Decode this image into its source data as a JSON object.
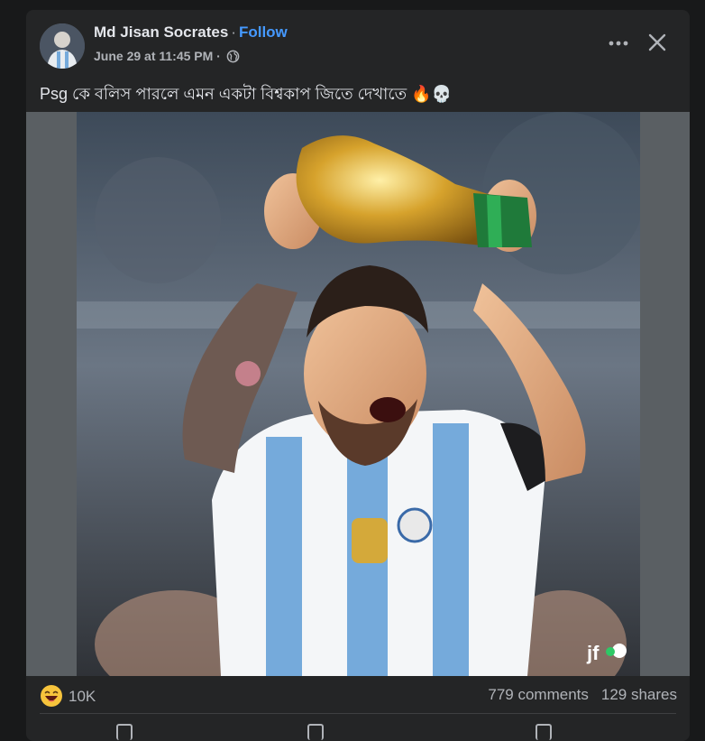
{
  "post": {
    "author": "Md Jisan Socrates",
    "separator": "·",
    "follow_label": "Follow",
    "timestamp": "June 29 at 11:45 PM ·",
    "privacy_icon": "globe-icon",
    "text": "Psg কে বলিস পারলে এমন একটা বিশ্বকাপ জিতে দেখাতে 🔥💀",
    "image_watermark": "jf"
  },
  "header": {
    "more_icon": "more-horizontal-icon",
    "close_icon": "close-icon"
  },
  "stats": {
    "reaction_icon": "haha-reaction-icon",
    "reaction_count": "10K",
    "comments": "779 comments",
    "shares": "129 shares"
  },
  "colors": {
    "background": "#18191a",
    "card": "#242526",
    "follow": "#4599ff",
    "secondary_text": "#b0b3b8",
    "jersey_blue": "#75aadb"
  }
}
